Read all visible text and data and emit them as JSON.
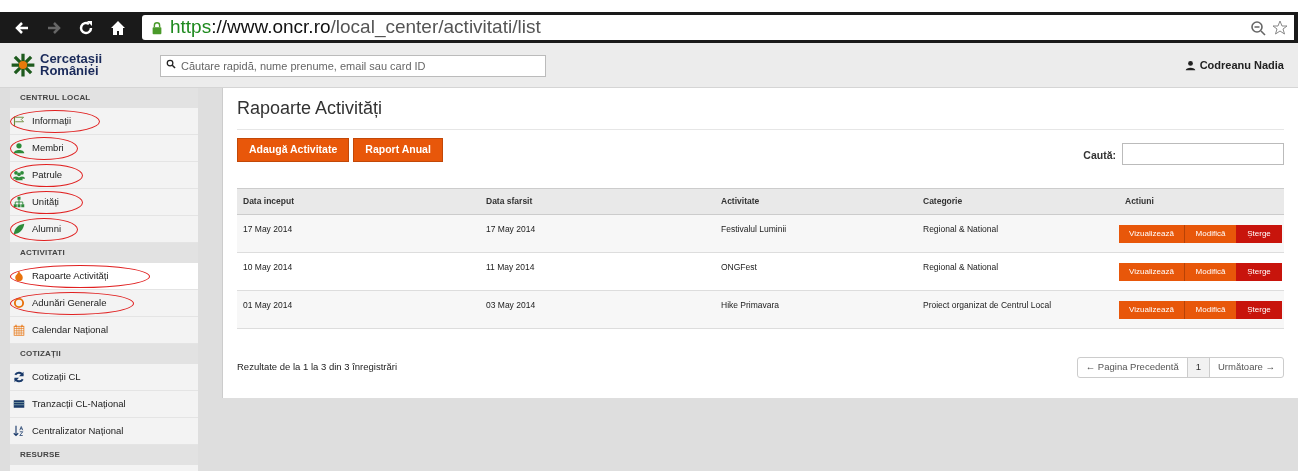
{
  "browser": {
    "url_scheme": "https",
    "url_host": "://www.oncr.ro",
    "url_path": "/local_center/activitati/list"
  },
  "header": {
    "logo_line1": "Cercetașii",
    "logo_line2": "României",
    "search_placeholder": "Căutare rapidă, nume prenume, email sau card ID",
    "user": "Codreanu Nadia"
  },
  "sidebar": {
    "sections": [
      {
        "title": "CENTRUL LOCAL",
        "items": [
          {
            "label": "Informații",
            "selected": false,
            "circled": true
          },
          {
            "label": "Membri",
            "selected": false,
            "circled": true
          },
          {
            "label": "Patrule",
            "selected": false,
            "circled": true
          },
          {
            "label": "Unități",
            "selected": false,
            "circled": true
          },
          {
            "label": "Alumni",
            "selected": false,
            "circled": true
          }
        ]
      },
      {
        "title": "ACTIVITATI",
        "items": [
          {
            "label": "Rapoarte Activități",
            "selected": true,
            "circled": true
          },
          {
            "label": "Adunări Generale",
            "selected": false,
            "circled": true
          },
          {
            "label": "Calendar Național",
            "selected": false,
            "circled": false
          }
        ]
      },
      {
        "title": "COTIZAȚII",
        "items": [
          {
            "label": "Cotizații CL",
            "selected": false,
            "circled": false
          },
          {
            "label": "Tranzacții CL-Național",
            "selected": false,
            "circled": false
          },
          {
            "label": "Centralizator Național",
            "selected": false,
            "circled": false
          }
        ]
      },
      {
        "title": "RESURSE"
      }
    ]
  },
  "main": {
    "title": "Rapoarte Activități",
    "buttons": [
      "Adaugă Activitate",
      "Raport Anual"
    ],
    "search_label": "Caută:",
    "table": {
      "columns": [
        "Data inceput",
        "Data sfarsit",
        "Activitate",
        "Categorie",
        "Actiuni"
      ],
      "rows": [
        {
          "cells": [
            "17 May 2014",
            "17 May 2014",
            "Festivalul Luminii",
            "Regional & National"
          ],
          "actions": [
            {
              "label": "Vizualizează",
              "kind": "view"
            },
            {
              "label": "Modifică",
              "kind": "edit"
            },
            {
              "label": "Șterge",
              "kind": "delete"
            }
          ]
        },
        {
          "cells": [
            "10 May 2014",
            "11 May 2014",
            "ONGFest",
            "Regional & National"
          ],
          "actions": [
            {
              "label": "Vizualizează",
              "kind": "view"
            },
            {
              "label": "Modifică",
              "kind": "edit"
            },
            {
              "label": "Șterge",
              "kind": "delete"
            }
          ]
        },
        {
          "cells": [
            "01 May 2014",
            "03 May 2014",
            "Hike Primavara",
            "Proiect organizat de Centrul Local"
          ],
          "actions": [
            {
              "label": "Vizualizează",
              "kind": "view"
            },
            {
              "label": "Modifică",
              "kind": "edit"
            },
            {
              "label": "Șterge",
              "kind": "delete"
            }
          ]
        }
      ]
    },
    "results": "Rezultate de la 1 la 3 din 3 înregistrări",
    "pagination": {
      "prev": "← Pagina Precedentă",
      "pages": [
        {
          "label": "1",
          "selected": true
        }
      ],
      "next": "Următoare →"
    }
  }
}
